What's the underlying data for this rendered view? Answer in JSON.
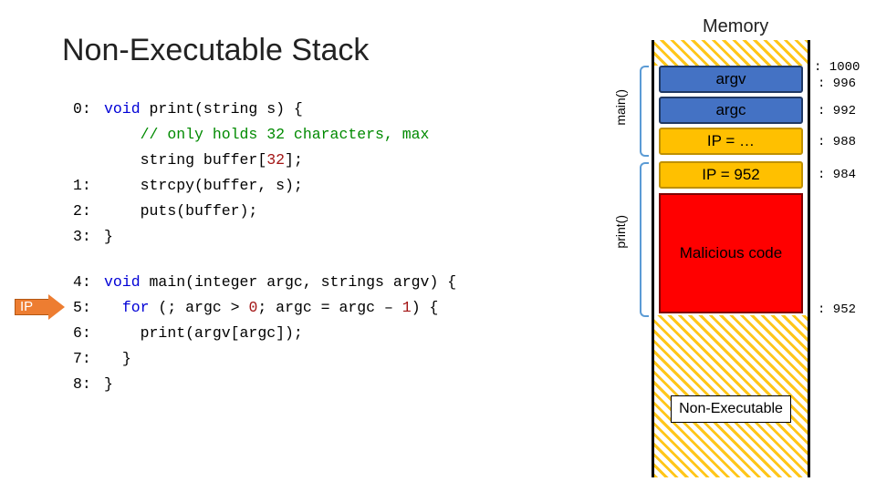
{
  "title": "Non-Executable Stack",
  "memory_title": "Memory",
  "ip_label": "IP",
  "func_labels": {
    "main": "main()",
    "print": "print()"
  },
  "code": {
    "l0_n": "0:",
    "l0_kw1": "void",
    "l0_fn": " print(string s) {",
    "l1_cm": "// only holds 32 characters, max",
    "l2_a": "string buffer[",
    "l2_num": "32",
    "l2_b": "];",
    "l3_n": "1:",
    "l3_t": "strcpy(buffer, s);",
    "l4_n": "2:",
    "l4_t": "puts(buffer);",
    "l5_n": "3:",
    "l5_t": "}",
    "l6_n": "4:",
    "l6_kw": "void",
    "l6_t": " main(integer argc, strings argv) {",
    "l7_n": "5:",
    "l7_kw": "for",
    "l7_a": " (; argc > ",
    "l7_z": "0",
    "l7_b": "; argc = argc – ",
    "l7_one": "1",
    "l7_c": ") {",
    "l8_n": "6:",
    "l8_t": "print(argv[argc]);",
    "l9_n": "7:",
    "l9_t": "}",
    "l10_n": "8:",
    "l10_t": "}"
  },
  "stack": {
    "argv": "argv",
    "argc": "argc",
    "ip_ellipsis": "IP = …",
    "ip_val": "IP = 952",
    "malicious": "Malicious code",
    "nonexec": "Non-Executable"
  },
  "addrs": {
    "a1000": ": 1000",
    "a996": ": 996",
    "a992": ": 992",
    "a988": ": 988",
    "a984": ": 984",
    "a952": ": 952"
  }
}
